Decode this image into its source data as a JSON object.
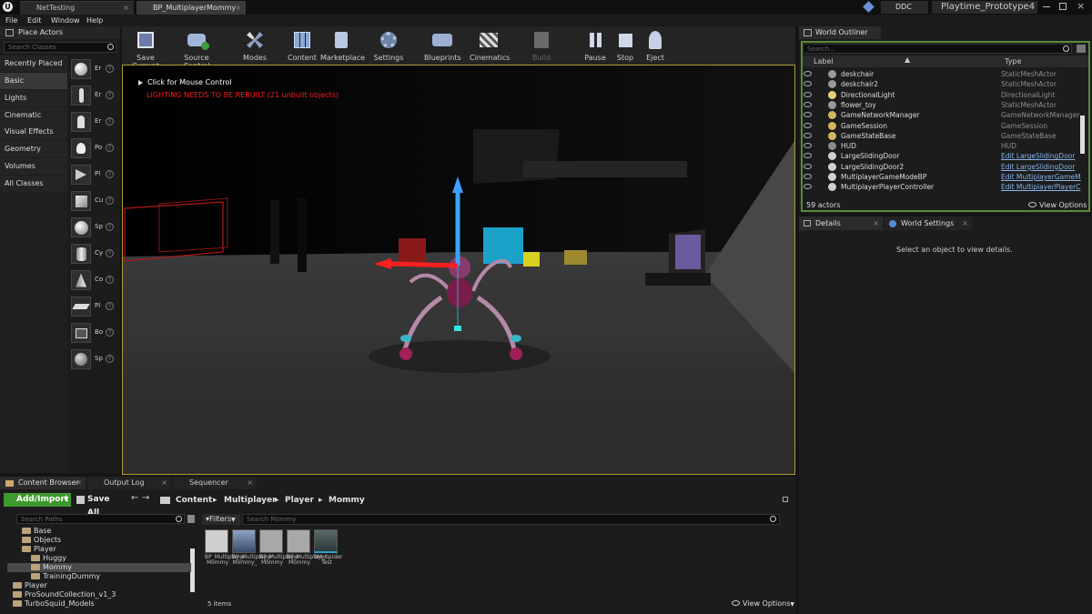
{
  "title_bar": {
    "tabs": [
      "NetTesting",
      "BP_MultiplayerMommy"
    ],
    "ddc": "DDC",
    "project": "Playtime_Prototype4"
  },
  "menu": [
    "File",
    "Edit",
    "Window",
    "Help"
  ],
  "place_actors": {
    "tab": "Place Actors",
    "search_placeholder": "Search Classes",
    "categories": [
      "Recently Placed",
      "Basic",
      "Lights",
      "Cinematic",
      "Visual Effects",
      "Geometry",
      "Volumes",
      "All Classes"
    ],
    "selected_category": "Basic",
    "items": [
      "Er",
      "Er",
      "Er",
      "Po",
      "Pl",
      "Cu",
      "Sp",
      "Cy",
      "Co",
      "Pl",
      "Bo",
      "Sp"
    ],
    "help": "?"
  },
  "toolbar": {
    "buttons": [
      "Save Current",
      "Source Control",
      "Modes",
      "Content",
      "Marketplace",
      "Settings",
      "Blueprints",
      "Cinematics",
      "Build",
      "Pause",
      "Stop",
      "Eject"
    ]
  },
  "viewport": {
    "hint": "Click for Mouse Control",
    "warning": "LIGHTING NEEDS TO BE REBUILT (21 unbuilt objects)"
  },
  "world_outliner": {
    "tab": "World Outliner",
    "search_placeholder": "Search...",
    "col_label": "Label",
    "col_type": "Type",
    "rows": [
      {
        "label": "deskchair",
        "type": "StaticMeshActor",
        "link": false,
        "color": "#9a9a9a"
      },
      {
        "label": "deskchair2",
        "type": "StaticMeshActor",
        "link": false,
        "color": "#9a9a9a"
      },
      {
        "label": "DirectionalLight",
        "type": "DirectionalLight",
        "link": false,
        "color": "#e6d27a"
      },
      {
        "label": "flower_toy",
        "type": "StaticMeshActor",
        "link": false,
        "color": "#9a9a9a"
      },
      {
        "label": "GameNetworkManager",
        "type": "GameNetworkManager",
        "link": false,
        "color": "#d4b560"
      },
      {
        "label": "GameSession",
        "type": "GameSession",
        "link": false,
        "color": "#d4b560"
      },
      {
        "label": "GameStateBase",
        "type": "GameStateBase",
        "link": false,
        "color": "#d4b560"
      },
      {
        "label": "HUD",
        "type": "HUD",
        "link": false,
        "color": "#8a8a8a"
      },
      {
        "label": "LargeSlidingDoor",
        "type": "Edit LargeSlidingDoor",
        "link": true,
        "color": "#d0d0d0"
      },
      {
        "label": "LargeSlidingDoor2",
        "type": "Edit LargeSlidingDoor",
        "link": true,
        "color": "#d0d0d0"
      },
      {
        "label": "MultiplayerGameModeBP",
        "type": "Edit MultiplayerGameM",
        "link": true,
        "color": "#d0d0d0"
      },
      {
        "label": "MultiplayerPlayerController",
        "type": "Edit MultiplayerPlayerC",
        "link": true,
        "color": "#d0d0d0"
      }
    ],
    "count": "59 actors",
    "view_options": "View Options"
  },
  "details": {
    "tabs": [
      "Details",
      "World Settings"
    ],
    "message": "Select an object to view details."
  },
  "content_browser": {
    "tabs": [
      "Content Browser",
      "Output Log",
      "Sequencer"
    ],
    "add_import": "Add/Import",
    "save_all": "Save All",
    "breadcrumb": [
      "Content",
      "Multiplayer",
      "Player",
      "Mommy"
    ],
    "search_paths": "Search Paths",
    "filters": "Filters",
    "search_assets": "Search Mommy",
    "tree": [
      {
        "label": "Base",
        "indent": 1
      },
      {
        "label": "Objects",
        "indent": 1
      },
      {
        "label": "Player",
        "indent": 1
      },
      {
        "label": "Huggy",
        "indent": 2
      },
      {
        "label": "Mommy",
        "indent": 2
      },
      {
        "label": "TrainingDummy",
        "indent": 2
      },
      {
        "label": "Player",
        "indent": 0
      },
      {
        "label": "ProSoundCollection_v1_3",
        "indent": 0
      },
      {
        "label": "TurboSquid_Models",
        "indent": 0
      }
    ],
    "selected_folder": "Mommy",
    "assets": [
      "BP_Multiplayer Mommy",
      "BP_Multiplayer Mommy_",
      "BP_Multiplayer Mommy",
      "BP_Multiplayer Mommy",
      "SM_Spider Test"
    ],
    "item_count": "5 items",
    "view_options": "View Options"
  }
}
